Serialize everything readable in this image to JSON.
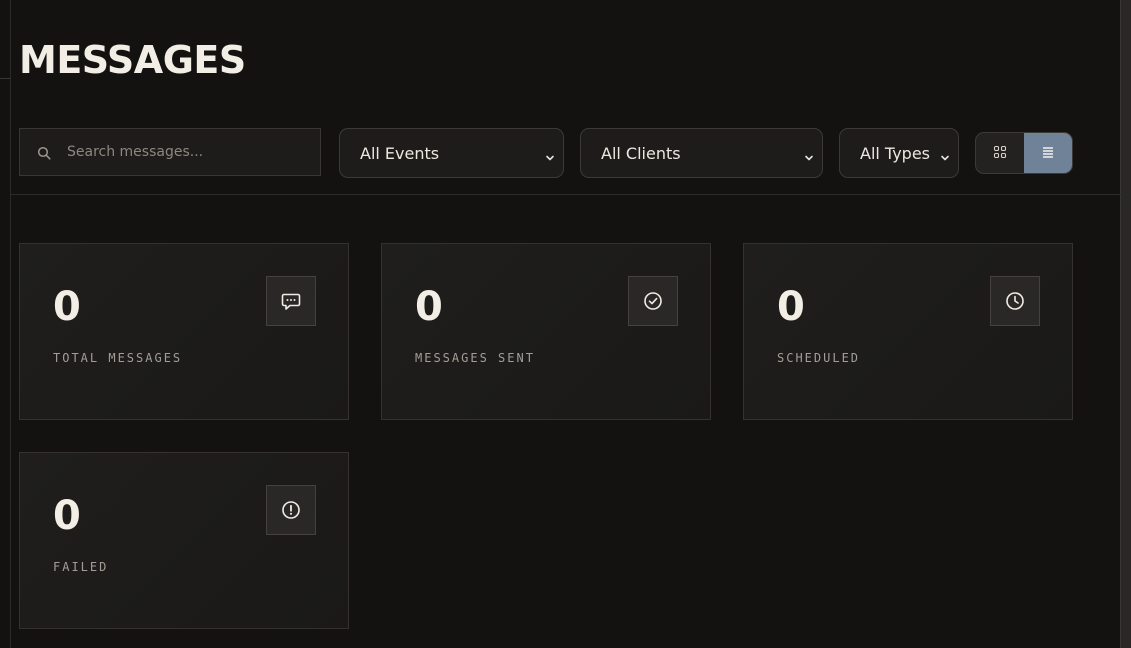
{
  "header": {
    "title": "MESSAGES"
  },
  "toolbar": {
    "search": {
      "placeholder": "Search messages...",
      "value": "",
      "icon": "search-icon"
    },
    "filters": {
      "events": "All Events",
      "clients": "All Clients",
      "types": "All Types"
    },
    "view_toggle": {
      "options": [
        "grid-view",
        "list-view"
      ],
      "selected": "list-view",
      "active_color": "#6f8297"
    }
  },
  "stats": [
    {
      "value": "0",
      "label": "TOTAL MESSAGES",
      "icon": "chat-bubble-icon"
    },
    {
      "value": "0",
      "label": "MESSAGES SENT",
      "icon": "check-circle-icon"
    },
    {
      "value": "0",
      "label": "SCHEDULED",
      "icon": "clock-icon"
    },
    {
      "value": "0",
      "label": "FAILED",
      "icon": "alert-circle-icon"
    }
  ],
  "colors": {
    "background": "#131211",
    "card": "#1e1c1a",
    "text": "#f2eee6",
    "muted": "#a39e95",
    "accent": "#6f8297"
  }
}
